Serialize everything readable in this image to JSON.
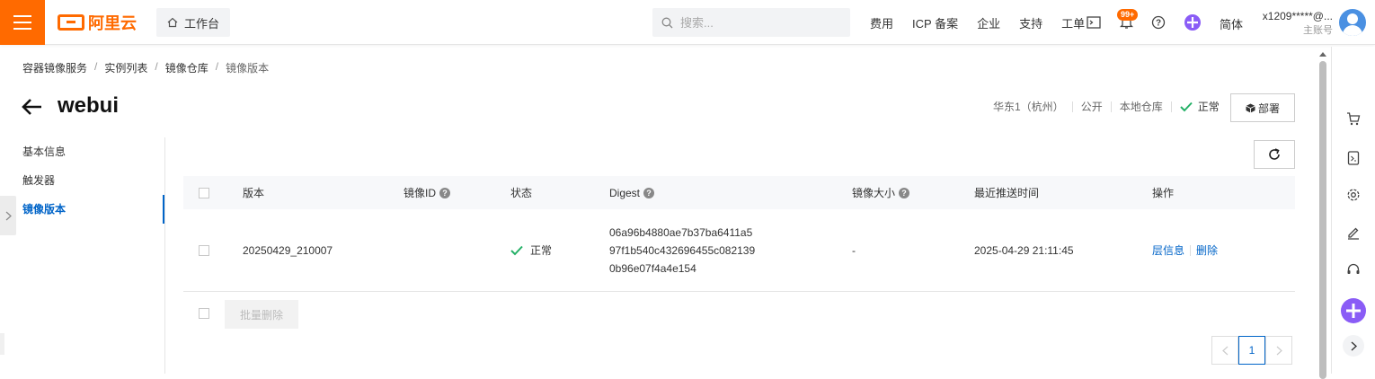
{
  "header": {
    "logo_text": "阿里云",
    "workbench_label": "工作台",
    "search_placeholder": "搜索...",
    "links": [
      "费用",
      "ICP 备案",
      "企业",
      "支持",
      "工单"
    ],
    "notification_badge": "99+",
    "language": "简体",
    "account_name": "x1209*****@...",
    "account_role": "主账号",
    "brand_color": "#ff6a00"
  },
  "breadcrumb": [
    "容器镜像服务",
    "实例列表",
    "镜像仓库",
    "镜像版本"
  ],
  "page": {
    "title": "webui",
    "region": "华东1（杭州）",
    "visibility": "公开",
    "repo_type": "本地仓库",
    "status": "正常",
    "deploy_label": "部署"
  },
  "leftmenu": {
    "items": [
      {
        "label": "基本信息",
        "active": false
      },
      {
        "label": "触发器",
        "active": false
      },
      {
        "label": "镜像版本",
        "active": true
      }
    ]
  },
  "table": {
    "headers": {
      "version": "版本",
      "image_id": "镜像ID",
      "status": "状态",
      "digest": "Digest",
      "size": "镜像大小",
      "pushed": "最近推送时间",
      "ops": "操作"
    },
    "rows": [
      {
        "version": "20250429_210007",
        "status": "正常",
        "digest_lines": [
          "06a96b4880ae7b37ba6411a5",
          "97f1b540c432696455c082139",
          "0b96e07f4a4e154"
        ],
        "size": "-",
        "pushed": "2025-04-29 21:11:45",
        "op_layers": "层信息",
        "op_delete": "删除"
      }
    ]
  },
  "footer": {
    "batch_delete": "批量删除"
  },
  "pagination": {
    "current_page": "1"
  },
  "colors": {
    "accent": "#0064c8",
    "success": "#23b066"
  }
}
